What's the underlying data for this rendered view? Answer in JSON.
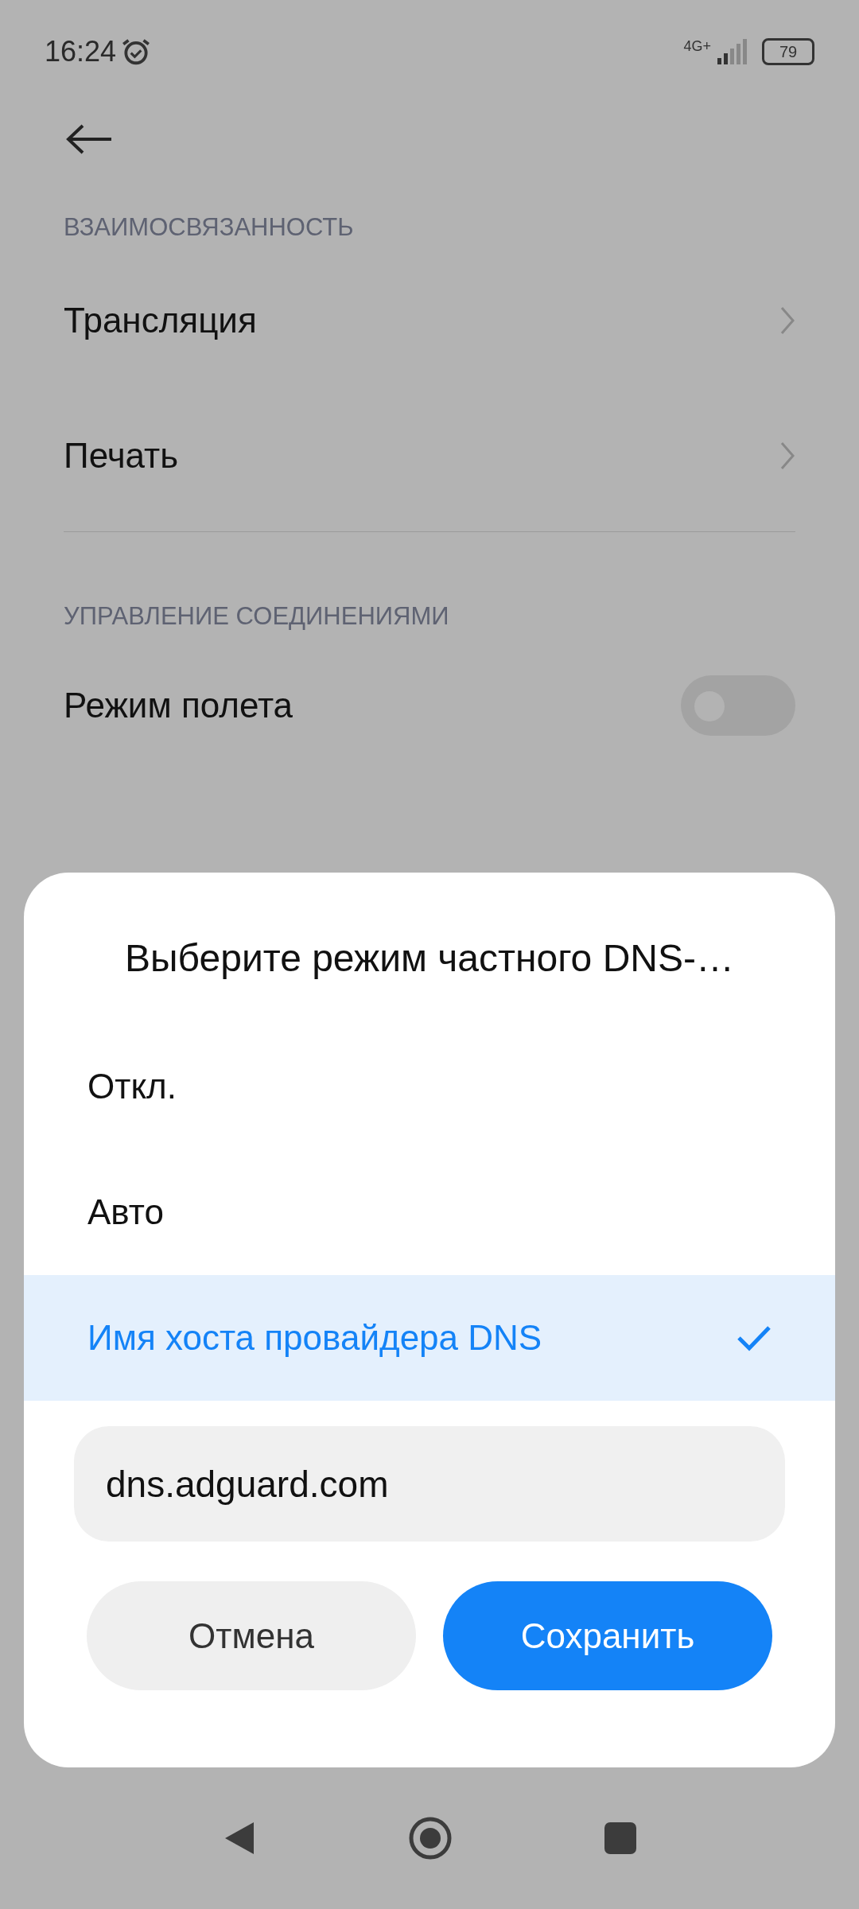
{
  "status_bar": {
    "time": "16:24",
    "network": "4G+",
    "battery": "79"
  },
  "sections": [
    {
      "header": "ВЗАИМОСВЯЗАННОСТЬ",
      "items": [
        {
          "kind": "link",
          "label": "Трансляция"
        },
        {
          "kind": "link",
          "label": "Печать"
        }
      ]
    },
    {
      "header": "УПРАВЛЕНИЕ СОЕДИНЕНИЯМИ",
      "items": [
        {
          "kind": "toggle",
          "label": "Режим полета",
          "on": false
        }
      ]
    }
  ],
  "dialog": {
    "title": "Выберите режим частного DNS-…",
    "options": [
      {
        "label": "Откл.",
        "selected": false
      },
      {
        "label": "Авто",
        "selected": false
      },
      {
        "label": "Имя хоста провайдера DNS",
        "selected": true
      }
    ],
    "hostname": {
      "value": "dns.adguard.com"
    },
    "buttons": [
      {
        "kind": "secondary",
        "label": "Отмена"
      },
      {
        "kind": "primary",
        "label": "Сохранить"
      }
    ]
  }
}
